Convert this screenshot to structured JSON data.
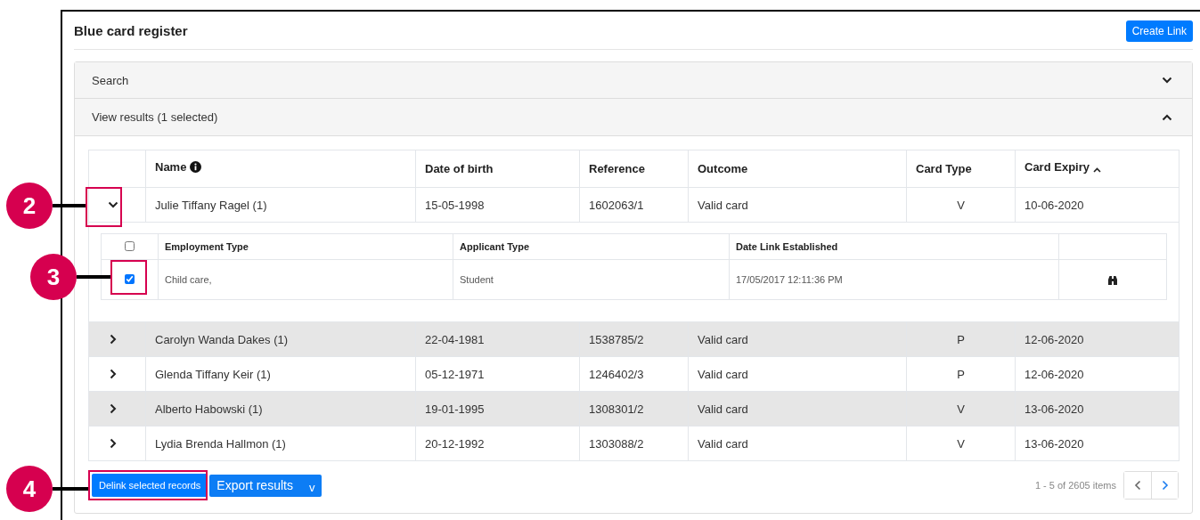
{
  "title": "Blue card register",
  "create_button": "Create Link",
  "panels": [
    {
      "label": "Search",
      "expanded": false
    },
    {
      "label": "View results (1 selected)",
      "expanded": true
    }
  ],
  "table": {
    "columns": [
      {
        "label": "Name",
        "kind": "info"
      },
      {
        "label": "Date of birth",
        "kind": "plain"
      },
      {
        "label": "Reference",
        "kind": "plain"
      },
      {
        "label": "Outcome",
        "kind": "plain"
      },
      {
        "label": "Card Type",
        "kind": "plain"
      },
      {
        "label": "Card Expiry",
        "kind": "sorted"
      }
    ],
    "rows": [
      {
        "name": "Julie Tiffany Ragel (1)",
        "dob": "15-05-1998",
        "reference": "1602063/1",
        "outcome": "Valid card",
        "card_type": "V",
        "expiry": "10-06-2020",
        "expanded": true,
        "details": {
          "columns": [
            "Employment Type",
            "Applicant Type",
            "Date Link Established"
          ],
          "select_all": {
            "checked": false
          },
          "rows": [
            {
              "checked": true,
              "employment_type": "Child care,",
              "applicant_type": "Student",
              "date_link": "17/05/2017 12:11:36 PM"
            }
          ]
        }
      },
      {
        "name": "Carolyn Wanda Dakes (1)",
        "dob": "22-04-1981",
        "reference": "1538785/2",
        "outcome": "Valid card",
        "card_type": "P",
        "expiry": "12-06-2020",
        "expanded": false
      },
      {
        "name": "Glenda Tiffany Keir (1)",
        "dob": "05-12-1971",
        "reference": "1246402/3",
        "outcome": "Valid card",
        "card_type": "P",
        "expiry": "12-06-2020",
        "expanded": false
      },
      {
        "name": "Alberto Habowski (1)",
        "dob": "19-01-1995",
        "reference": "1308301/2",
        "outcome": "Valid card",
        "card_type": "V",
        "expiry": "13-06-2020",
        "expanded": false
      },
      {
        "name": "Lydia Brenda Hallmon (1)",
        "dob": "20-12-1992",
        "reference": "1303088/2",
        "outcome": "Valid card",
        "card_type": "V",
        "expiry": "13-06-2020",
        "expanded": false
      }
    ]
  },
  "actions": [
    {
      "label": "Delink selected records",
      "kind": "delink"
    },
    {
      "label": "Export results",
      "caret": "v",
      "kind": "export"
    }
  ],
  "pagination": {
    "summary": "1 - 5 of 2605 items",
    "previous_disabled": true
  },
  "callouts": [
    {
      "label": "2"
    },
    {
      "label": "3"
    },
    {
      "label": "4"
    }
  ]
}
